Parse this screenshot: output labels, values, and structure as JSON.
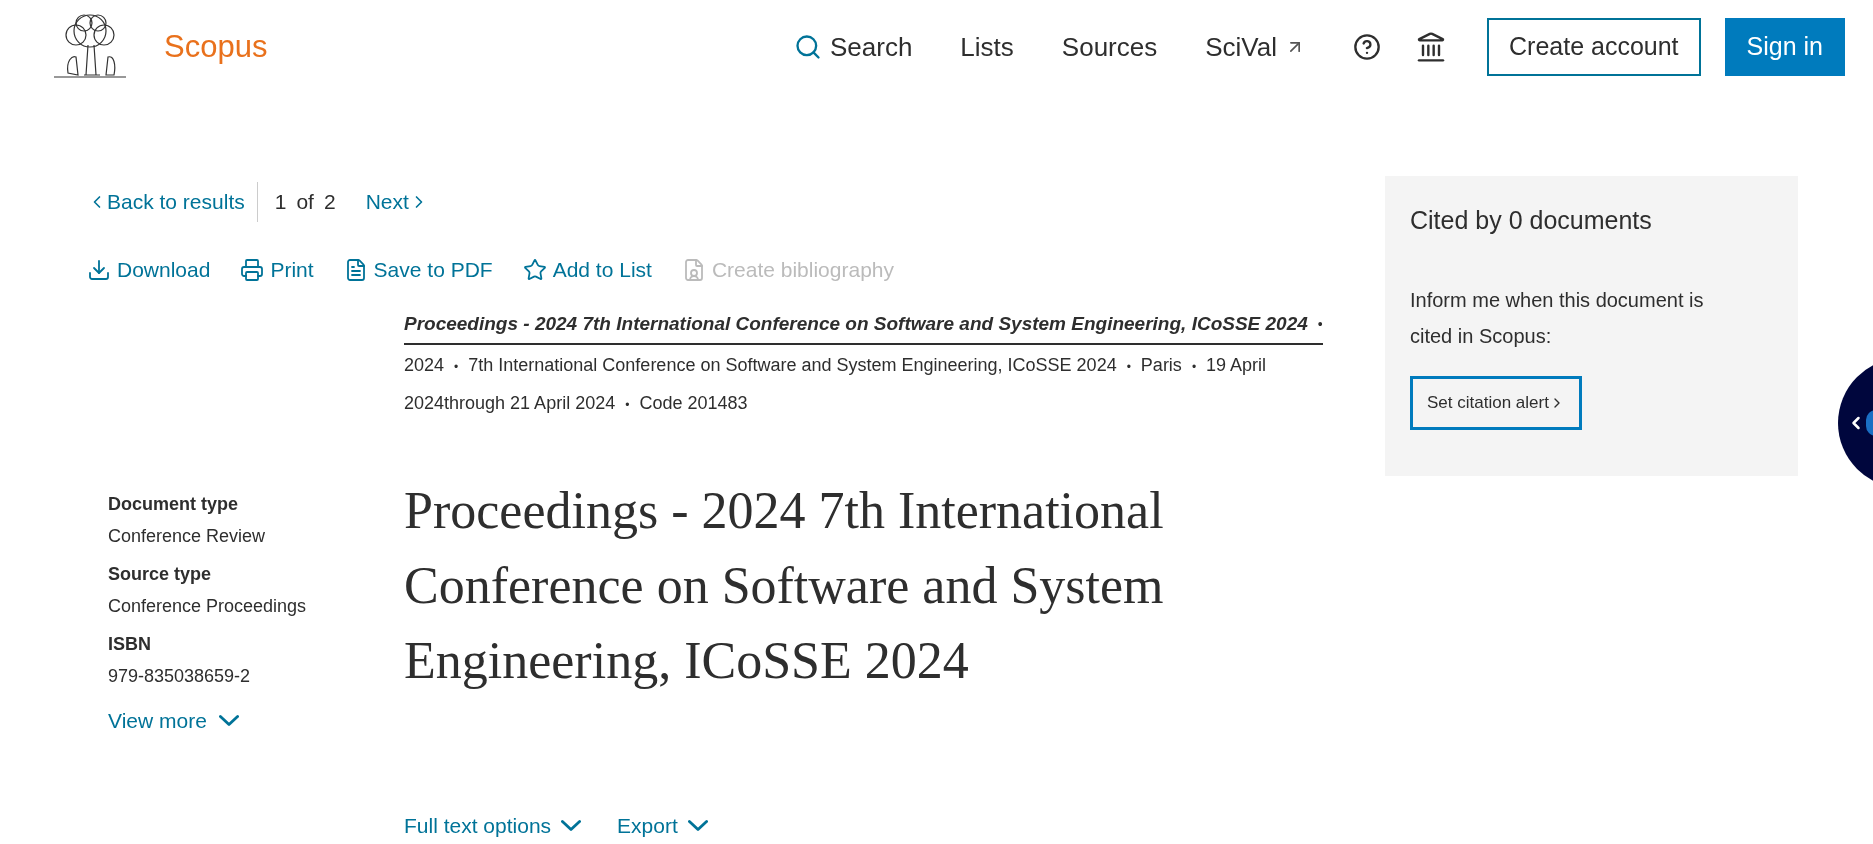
{
  "header": {
    "brand": "Scopus",
    "nav": [
      {
        "label": "Search",
        "kind": "search"
      },
      {
        "label": "Lists",
        "kind": "plain"
      },
      {
        "label": "Sources",
        "kind": "plain"
      },
      {
        "label": "SciVal",
        "kind": "external"
      }
    ],
    "create_account": "Create account",
    "sign_in": "Sign in"
  },
  "record_nav": {
    "back": "Back to results",
    "current": "1",
    "of": "of",
    "total": "2",
    "next": "Next"
  },
  "actions": [
    {
      "label": "Download",
      "kind": "download",
      "disabled": false
    },
    {
      "label": "Print",
      "kind": "print",
      "disabled": false
    },
    {
      "label": "Save to PDF",
      "kind": "pdf",
      "disabled": false
    },
    {
      "label": "Add to List",
      "kind": "star",
      "disabled": false
    },
    {
      "label": "Create bibliography",
      "kind": "bibliography",
      "disabled": true
    }
  ],
  "source": {
    "title": "Proceedings - 2024 7th International Conference on Software and System Engineering, ICoSSE 2024",
    "separator": "•",
    "details": [
      "2024",
      "7th International Conference on Software and System Engineering, ICoSSE 2024",
      "Paris",
      "19 April 2024through 21 April 2024",
      "Code 201483"
    ]
  },
  "metadata": [
    {
      "label": "Document type",
      "value": "Conference Review"
    },
    {
      "label": "Source type",
      "value": "Conference Proceedings"
    },
    {
      "label": "ISBN",
      "value": "979-835038659-2"
    }
  ],
  "view_more": "View more",
  "title": "Proceedings - 2024 7th International Conference on Software and System Engineering, ICoSSE 2024",
  "bottom_actions": [
    "Full text options",
    "Export"
  ],
  "cited_panel": {
    "heading": "Cited by 0 documents",
    "text": "Inform me when this document is cited in Scopus:",
    "button": "Set citation alert"
  }
}
